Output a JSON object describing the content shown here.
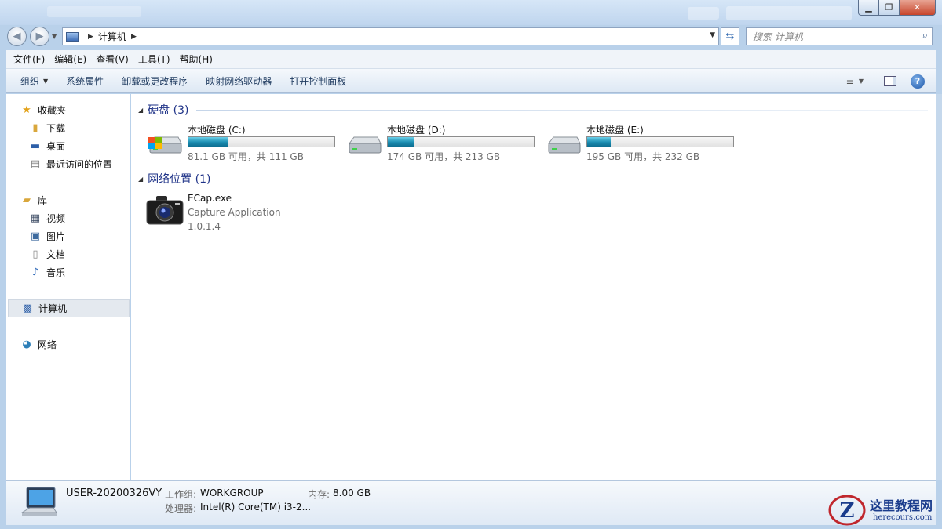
{
  "address": {
    "crumbs": [
      "计算机"
    ]
  },
  "search": {
    "placeholder": "搜索 计算机"
  },
  "menu": [
    "文件(F)",
    "编辑(E)",
    "查看(V)",
    "工具(T)",
    "帮助(H)"
  ],
  "commands": {
    "organize": "组织",
    "items": [
      "系统属性",
      "卸载或更改程序",
      "映射网络驱动器",
      "打开控制面板"
    ]
  },
  "nav": {
    "favorites": {
      "label": "收藏夹",
      "items": [
        "下载",
        "桌面",
        "最近访问的位置"
      ]
    },
    "libraries": {
      "label": "库",
      "items": [
        "视频",
        "图片",
        "文档",
        "音乐"
      ]
    },
    "computer": "计算机",
    "network": "网络"
  },
  "groups": {
    "hard_disks": {
      "title": "硬盘 (3)"
    },
    "network_locations": {
      "title": "网络位置 (1)"
    }
  },
  "drives": [
    {
      "name": "本地磁盘 (C:)",
      "free_text": "81.1 GB 可用，共 111 GB",
      "used_fraction": 0.27,
      "icon": "windows-drive-icon"
    },
    {
      "name": "本地磁盘 (D:)",
      "free_text": "174 GB 可用，共 213 GB",
      "used_fraction": 0.18,
      "icon": "hard-drive-icon"
    },
    {
      "name": "本地磁盘 (E:)",
      "free_text": "195 GB 可用，共 232 GB",
      "used_fraction": 0.16,
      "icon": "hard-drive-icon"
    }
  ],
  "network_item": {
    "name": "ECap.exe",
    "description": "Capture Application",
    "version": "1.0.1.4",
    "icon": "camera-icon"
  },
  "details": {
    "computer_name": "USER-20200326VY",
    "workgroup_label": "工作组:",
    "workgroup_value": "WORKGROUP",
    "memory_label": "内存:",
    "memory_value": "8.00 GB",
    "processor_label": "处理器:",
    "processor_value": "Intel(R) Core(TM) i3-2..."
  },
  "watermark": {
    "text": "这里教程网",
    "url": "herecours.com"
  },
  "colors": {
    "accent": "#1e3287",
    "drive_fill": "#1a8cb0"
  }
}
